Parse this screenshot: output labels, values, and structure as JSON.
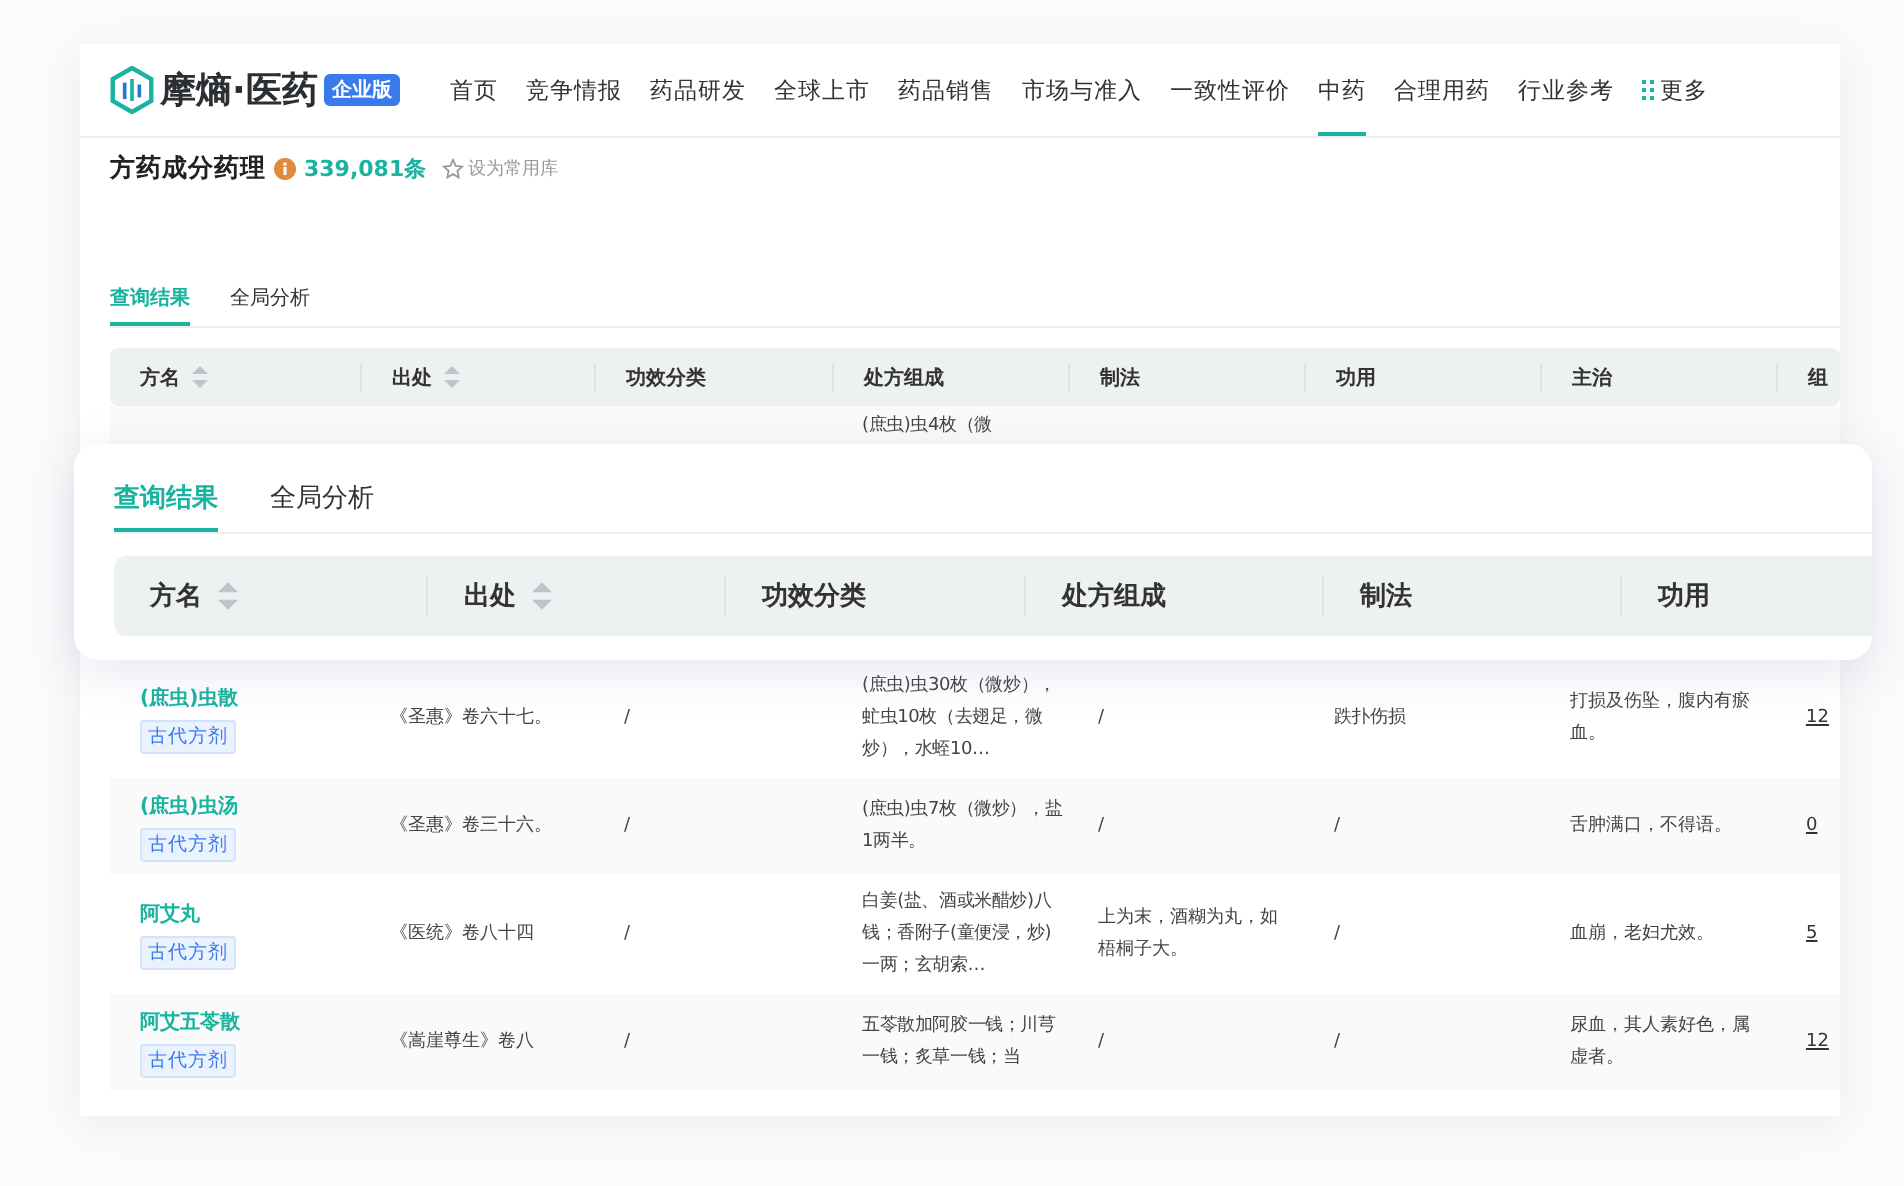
{
  "brand": {
    "name": "摩熵·医药",
    "edition": "企业版"
  },
  "nav": [
    {
      "label": "首页",
      "selected": false
    },
    {
      "label": "竞争情报",
      "selected": false
    },
    {
      "label": "药品研发",
      "selected": false
    },
    {
      "label": "全球上市",
      "selected": false
    },
    {
      "label": "药品销售",
      "selected": false
    },
    {
      "label": "市场与准入",
      "selected": false
    },
    {
      "label": "一致性评价",
      "selected": false
    },
    {
      "label": "中药",
      "selected": true
    },
    {
      "label": "合理用药",
      "selected": false
    },
    {
      "label": "行业参考",
      "selected": false
    }
  ],
  "more": {
    "label": "更多"
  },
  "database": {
    "title": "方药成分药理",
    "count": "339,081条",
    "favorite": "设为常用库"
  },
  "tabs": [
    {
      "label": "查询结果",
      "selected": true
    },
    {
      "label": "全局分析",
      "selected": false
    }
  ],
  "columns": [
    {
      "label": "方名",
      "sortable": true
    },
    {
      "label": "出处",
      "sortable": true
    },
    {
      "label": "功效分类",
      "sortable": false
    },
    {
      "label": "处方组成",
      "sortable": false
    },
    {
      "label": "制法",
      "sortable": false
    },
    {
      "label": "功用",
      "sortable": false
    },
    {
      "label": "主治",
      "sortable": false
    },
    {
      "label": "组",
      "sortable": false
    }
  ],
  "rows": [
    {
      "composition": "(庶虫)虫4枚（微"
    },
    {
      "name": "(庶虫)虫散",
      "tag": "古代方剂",
      "source": "《圣惠》卷六十七。",
      "category": "/",
      "composition": "(庶虫)虫30枚（微炒），虻虫10枚（去翅足，微炒），水蛭10…",
      "preparation": "/",
      "function": "跌扑伤损",
      "indication": "打损及伤坠，腹内有瘀血。",
      "count": "12"
    },
    {
      "name": "(庶虫)虫汤",
      "tag": "古代方剂",
      "source": "《圣惠》卷三十六。",
      "category": "/",
      "composition": "(庶虫)虫7枚（微炒），盐1两半。",
      "preparation": "/",
      "function": "/",
      "indication": "舌肿满口，不得语。",
      "count": "0"
    },
    {
      "name": "阿艾丸",
      "tag": "古代方剂",
      "source": "《医统》卷八十四",
      "category": "/",
      "composition": "白姜(盐、酒或米醋炒)八钱；香附子(童便浸，炒)一两；玄胡索…",
      "preparation": "上为末，酒糊为丸，如梧桐子大。",
      "function": "/",
      "indication": "血崩，老妇尤效。",
      "count": "5"
    },
    {
      "name": "阿艾五苓散",
      "tag": "古代方剂",
      "source": "《嵩崖尊生》卷八",
      "category": "/",
      "composition": "五苓散加阿胶一钱；川芎一钱；炙草一钱；当",
      "preparation": "/",
      "function": "/",
      "indication": "尿血，其人素好色，属虚者。",
      "count": "12"
    }
  ],
  "zoom_card": {
    "tabs": [
      {
        "label": "查询结果",
        "selected": true
      },
      {
        "label": "全局分析",
        "selected": false
      }
    ],
    "columns": [
      {
        "label": "方名",
        "sortable": true
      },
      {
        "label": "出处",
        "sortable": true
      },
      {
        "label": "功效分类",
        "sortable": false
      },
      {
        "label": "处方组成",
        "sortable": false
      },
      {
        "label": "制法",
        "sortable": false
      },
      {
        "label": "功用",
        "sortable": false
      }
    ]
  }
}
